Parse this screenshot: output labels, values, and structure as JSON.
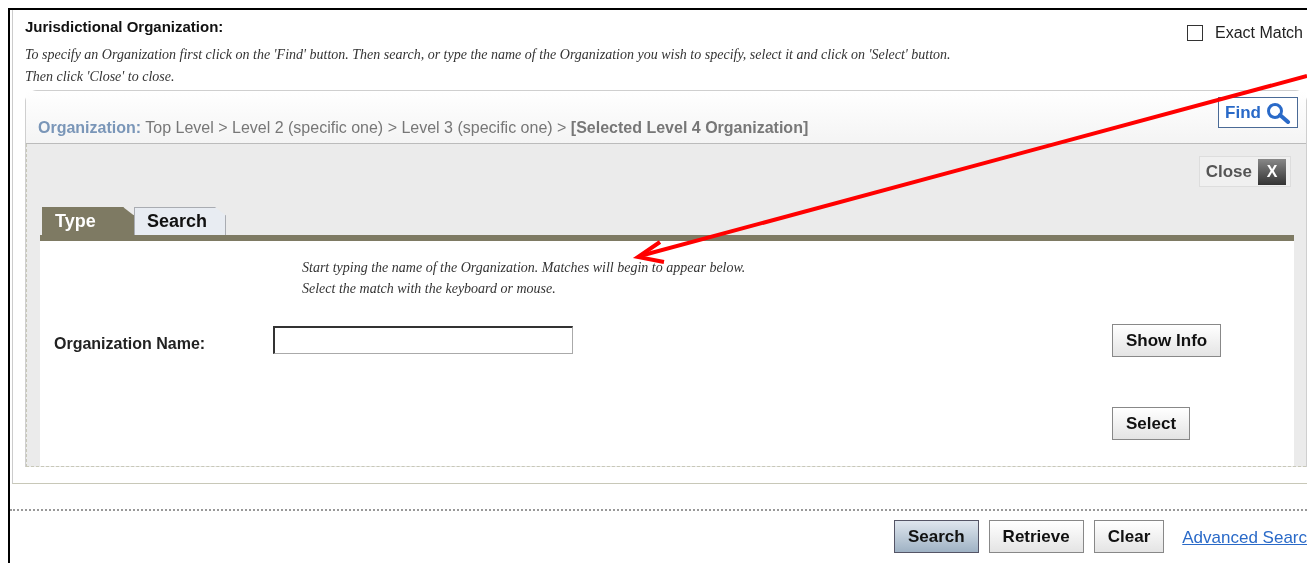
{
  "section_title": "Jurisdictional Organization:",
  "exact_match": {
    "label": "Exact Match",
    "checked": false
  },
  "instruction_lines": [
    "To specify an Organization first click on the 'Find' button. Then search, or type the name of the Organization you wish to specify, select it and click on 'Select' button.",
    "Then click 'Close' to close."
  ],
  "breadcrumb": {
    "label": "Organization:",
    "path": "Top Level > Level 2 (specific one) > Level 3 (specific one) >",
    "selected": "[Selected Level 4 Organization]"
  },
  "find_button": "Find",
  "close_button": {
    "label": "Close",
    "icon_text": "X"
  },
  "tabs": [
    {
      "label": "Type",
      "selected": true
    },
    {
      "label": "Search",
      "selected": false
    }
  ],
  "hint_lines": [
    "Start typing the name of the Organization. Matches will begin to appear below.",
    "Select the match with the keyboard or mouse."
  ],
  "field": {
    "label": "Organization Name:"
  },
  "side_buttons": [
    "Show Info",
    "Select"
  ],
  "footer_buttons": [
    {
      "label": "Search",
      "selected": true
    },
    {
      "label": "Retrieve",
      "selected": false
    },
    {
      "label": "Clear",
      "selected": false
    }
  ],
  "advanced_link": "Advanced Searc"
}
